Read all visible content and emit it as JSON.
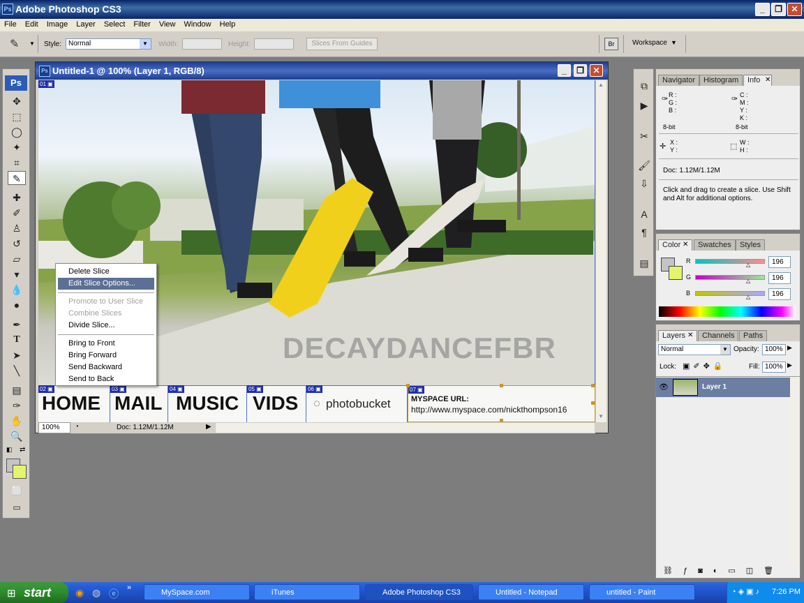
{
  "app": {
    "title": "Adobe Photoshop CS3",
    "icon_text": "Ps"
  },
  "window_controls": {
    "minimize": "_",
    "restore": "❐",
    "close": "✕"
  },
  "menus": [
    "File",
    "Edit",
    "Image",
    "Layer",
    "Select",
    "Filter",
    "View",
    "Window",
    "Help"
  ],
  "options_bar": {
    "style_label": "Style:",
    "style_value": "Normal",
    "width_label": "Width:",
    "height_label": "Height:",
    "slices_button": "Slices From Guides",
    "workspace_label": "Workspace"
  },
  "document": {
    "title": "Untitled-1 @ 100% (Layer 1, RGB/8)",
    "zoom": "100%",
    "doc_size": "Doc: 1.12M/1.12M",
    "watermark": "DECAYDANCEFBR",
    "slices": [
      "01",
      "02",
      "03",
      "04",
      "05",
      "06",
      "07"
    ],
    "nav": {
      "home": "HOME",
      "mail": "MAIL",
      "music": "MUSIC",
      "vids": "VIDS",
      "photobucket": "photobucket",
      "myspace_label": "MYSPACE URL:",
      "myspace_url": "http://www.myspace.com/nickthompson16"
    }
  },
  "context_menu": {
    "items": [
      {
        "label": "Delete Slice",
        "state": "normal"
      },
      {
        "label": "Edit Slice Options...",
        "state": "highlighted"
      },
      {
        "label": "Promote to User Slice",
        "state": "disabled"
      },
      {
        "label": "Combine Slices",
        "state": "disabled"
      },
      {
        "label": "Divide Slice...",
        "state": "normal"
      },
      {
        "label": "Bring to Front",
        "state": "normal"
      },
      {
        "label": "Bring Forward",
        "state": "normal"
      },
      {
        "label": "Send Backward",
        "state": "normal"
      },
      {
        "label": "Send to Back",
        "state": "normal"
      }
    ]
  },
  "info_panel": {
    "tabs": [
      "Navigator",
      "Histogram",
      "Info"
    ],
    "active_tab": "Info",
    "r": "R :",
    "g": "G :",
    "b": "B :",
    "c": "C :",
    "m": "M :",
    "y": "Y :",
    "k": "K :",
    "bit_left": "8-bit",
    "bit_right": "8-bit",
    "x": "X :",
    "yy": "Y :",
    "w": "W :",
    "h": "H :",
    "doc": "Doc: 1.12M/1.12M",
    "hint": "Click and drag to create a slice. Use Shift and Alt for additional options."
  },
  "color_panel": {
    "tabs": [
      "Color",
      "Swatches",
      "Styles"
    ],
    "active_tab": "Color",
    "r_label": "R",
    "g_label": "G",
    "b_label": "B",
    "r_value": "196",
    "g_value": "196",
    "b_value": "196",
    "foreground": "#c4c4c4",
    "background": "#e4f46c"
  },
  "layers_panel": {
    "tabs": [
      "Layers",
      "Channels",
      "Paths"
    ],
    "active_tab": "Layers",
    "blend_mode": "Normal",
    "opacity_label": "Opacity:",
    "opacity_value": "100%",
    "lock_label": "Lock:",
    "fill_label": "Fill:",
    "fill_value": "100%",
    "layers": [
      {
        "name": "Layer 1",
        "visible": true
      }
    ]
  },
  "taskbar": {
    "start": "start",
    "items": [
      {
        "label": "MySpace.com",
        "active": false
      },
      {
        "label": "iTunes",
        "active": false
      },
      {
        "label": "Adobe Photoshop CS3",
        "active": true
      },
      {
        "label": "Untitled - Notepad",
        "active": false
      },
      {
        "label": "untitled - Paint",
        "active": false
      }
    ],
    "clock": "7:26 PM"
  }
}
